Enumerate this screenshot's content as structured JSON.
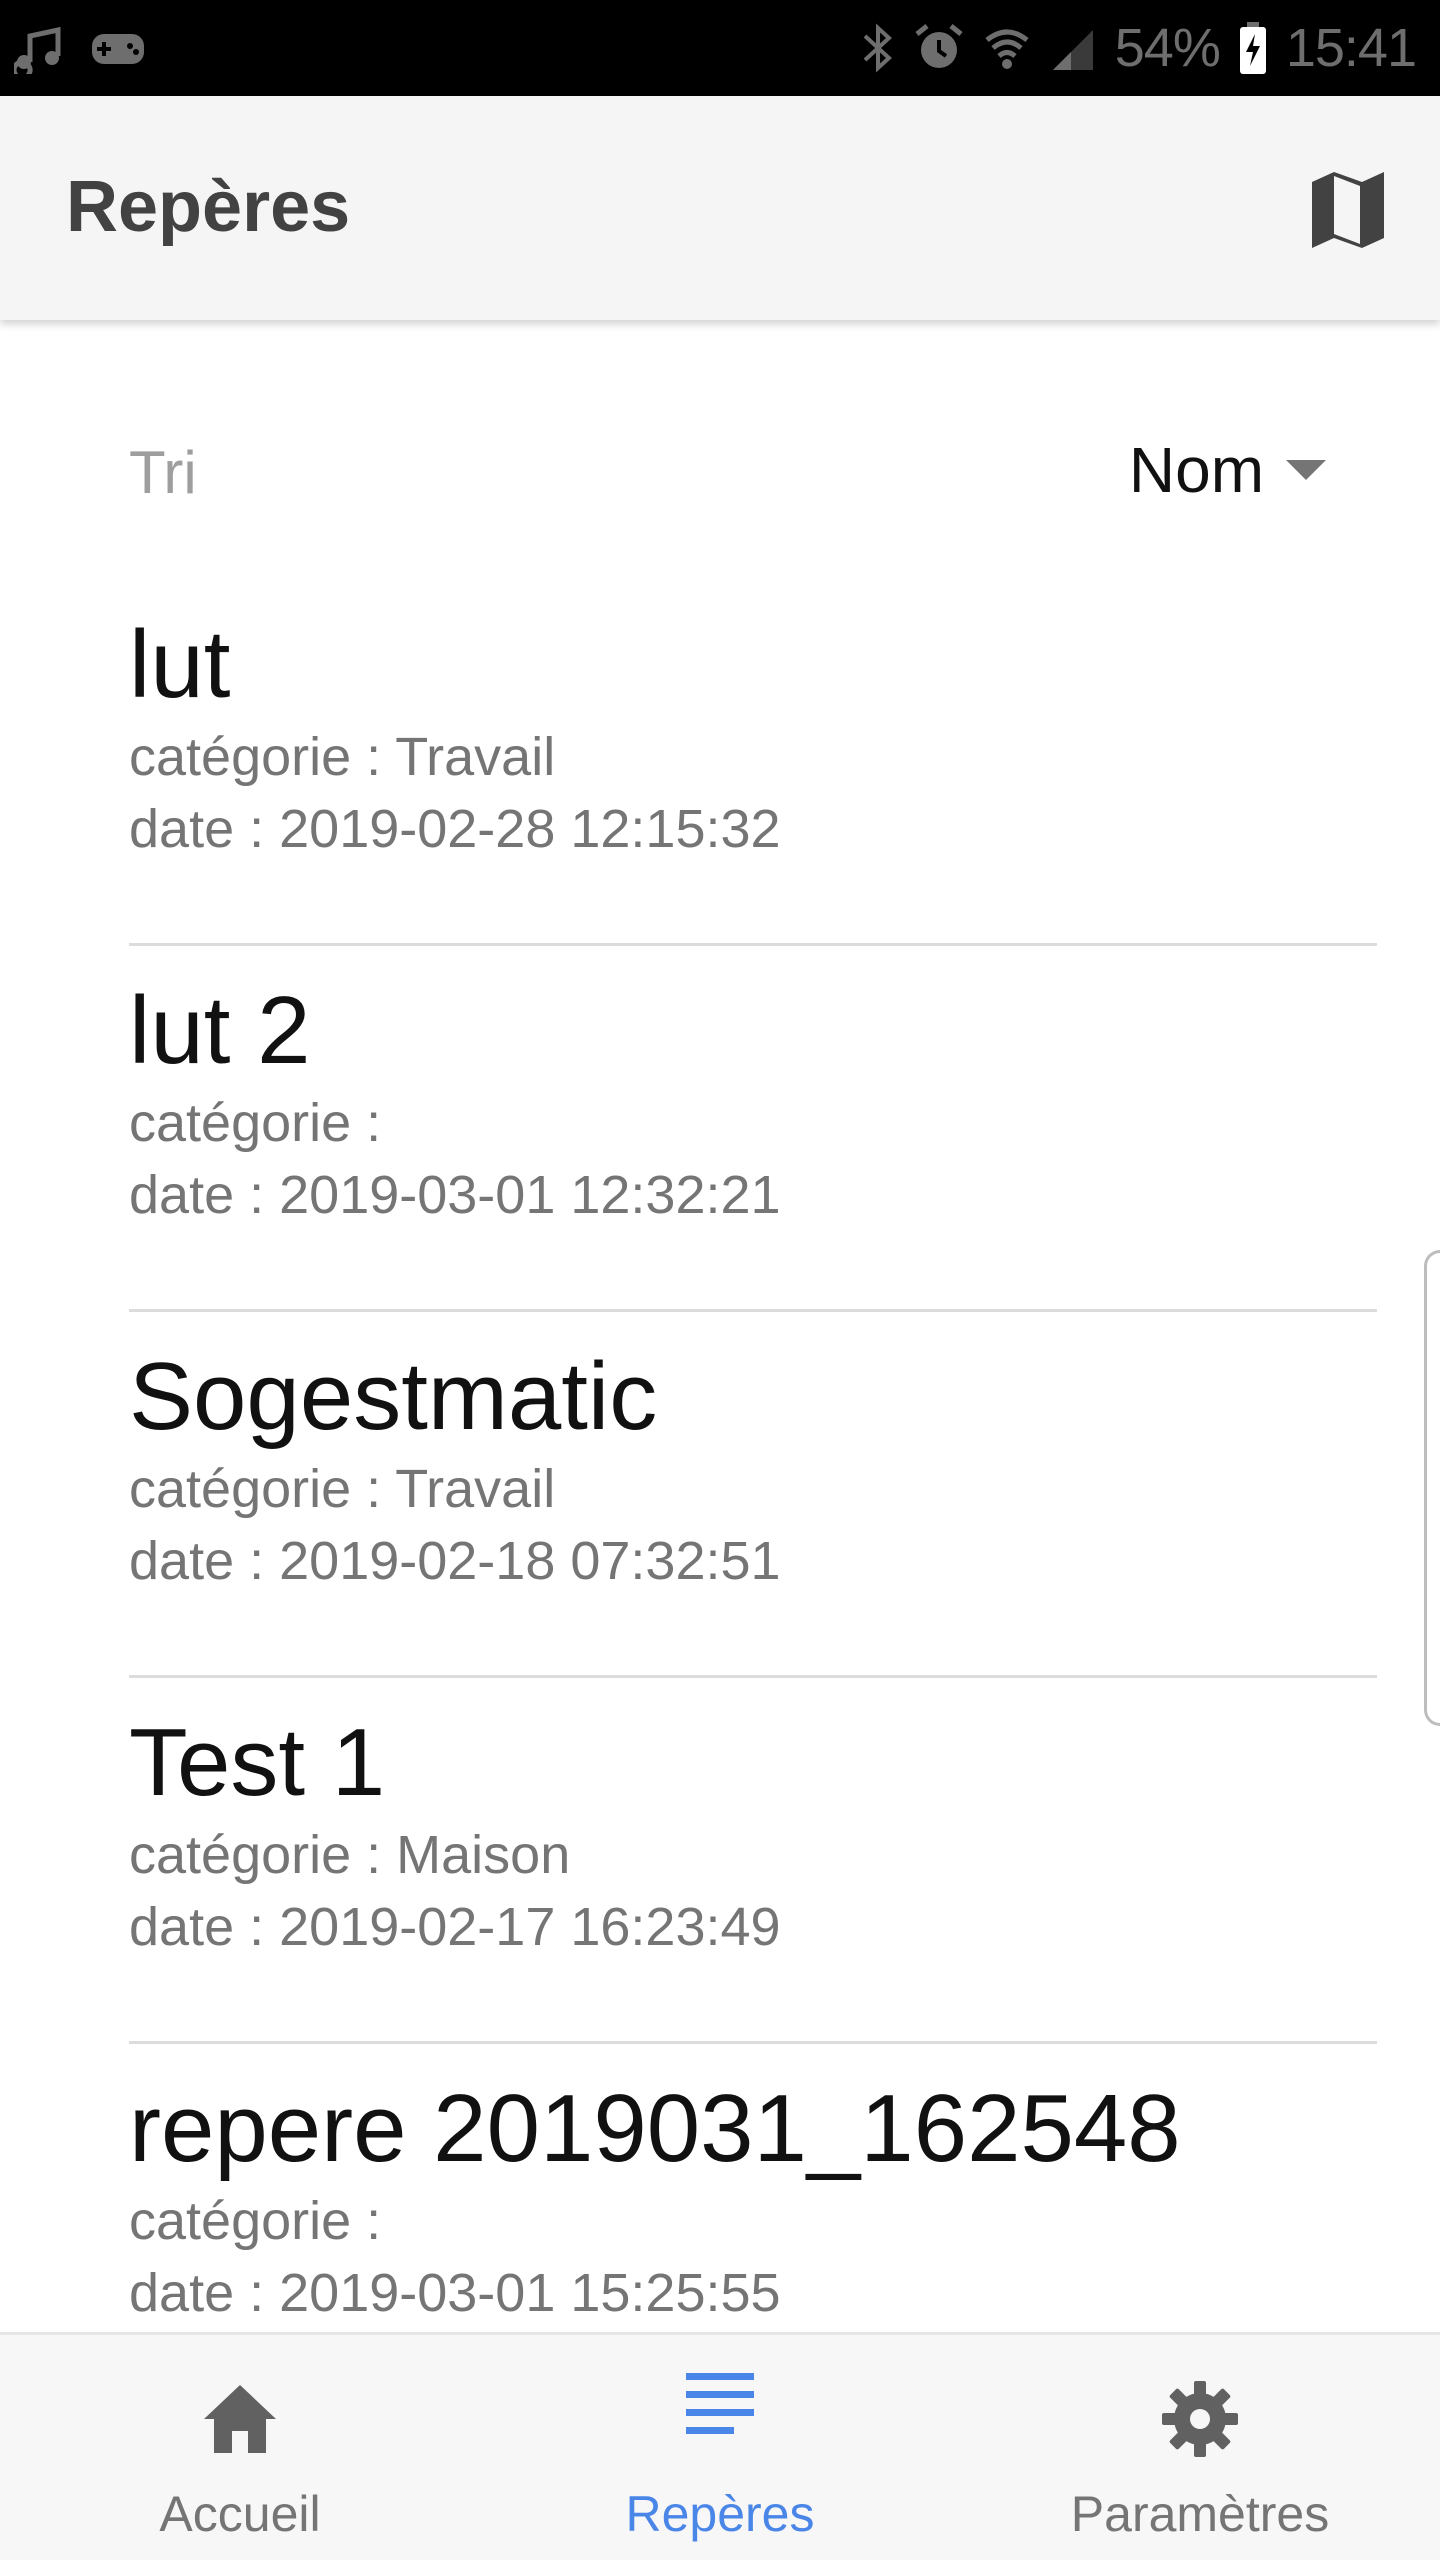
{
  "status_bar": {
    "battery": "54%",
    "time": "15:41",
    "icons": [
      "music-icon",
      "controller-icon",
      "bluetooth-icon",
      "alarm-icon",
      "wifi-icon",
      "signal-icon",
      "battery-charging-icon"
    ]
  },
  "app_bar": {
    "title": "Repères",
    "action_icon": "map-icon"
  },
  "sort": {
    "label": "Tri",
    "selected": "Nom"
  },
  "markers": [
    {
      "name": "lut",
      "category_label": "catégorie :",
      "category": "Travail",
      "date_label": "date :",
      "date": "2019-02-28 12:15:32"
    },
    {
      "name": "lut 2",
      "category_label": "catégorie :",
      "category": "",
      "date_label": "date :",
      "date": "2019-03-01 12:32:21"
    },
    {
      "name": "Sogestmatic",
      "category_label": "catégorie :",
      "category": "Travail",
      "date_label": "date :",
      "date": "2019-02-18 07:32:51"
    },
    {
      "name": "Test 1",
      "category_label": "catégorie :",
      "category": "Maison",
      "date_label": "date :",
      "date": "2019-02-17 16:23:49"
    },
    {
      "name": "repere 2019031_162548",
      "category_label": "catégorie :",
      "category": "",
      "date_label": "date :",
      "date": "2019-03-01 15:25:55"
    }
  ],
  "bottom_nav": {
    "items": [
      {
        "label": "Accueil",
        "icon": "home-icon",
        "active": false
      },
      {
        "label": "Repères",
        "icon": "list-icon",
        "active": true
      },
      {
        "label": "Paramètres",
        "icon": "gear-icon",
        "active": false
      }
    ]
  },
  "colors": {
    "accent": "#4a86e8",
    "app_bar": "#f5f5f5",
    "inactive": "#757575"
  }
}
